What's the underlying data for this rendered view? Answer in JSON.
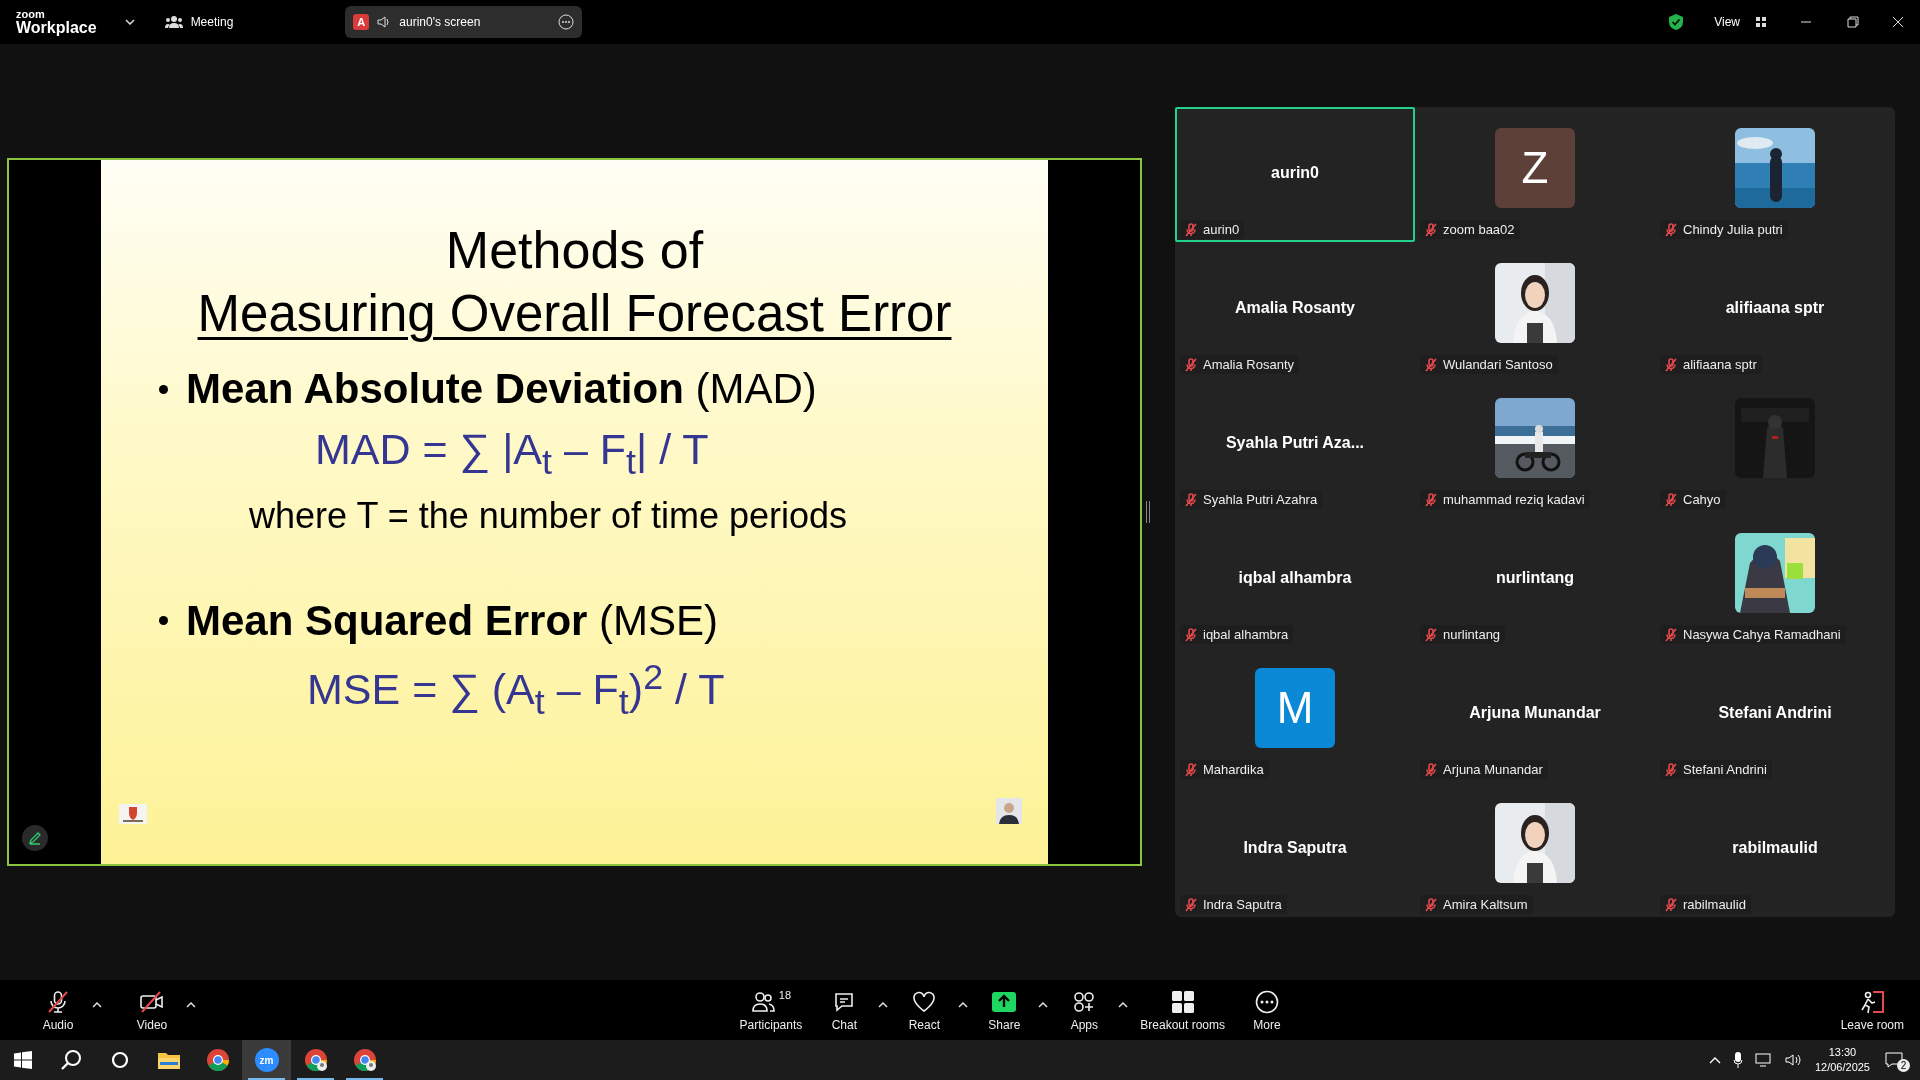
{
  "title_bar": {
    "logo_small": "zoom",
    "logo": "Workplace",
    "meeting_label": "Meeting",
    "share_pill": {
      "badge": "A",
      "label": "aurin0's screen"
    },
    "view_label": "View"
  },
  "shared_screen": {
    "slide": {
      "title_line1": "Methods of",
      "title_line2": "Measuring Overall Forecast Error",
      "sections": [
        {
          "heading": "**Mean Absolute Deviation** (MAD)",
          "formula": "MAD = ∑ |A$_{t}$ – F$_{t}$| / T",
          "note": "where T = the number of time periods"
        },
        {
          "heading": "**Mean Squared Error** (MSE)",
          "formula": "MSE = ∑ (A$_{t}$ – F$_{t}$)$^{2}$ / T"
        }
      ]
    }
  },
  "gallery": [
    {
      "kind": "name",
      "display": "aurin0",
      "name": "aurin0",
      "muted": true,
      "selected": true
    },
    {
      "kind": "initial",
      "display": "Z",
      "color": "#5d4037",
      "name": "zoom baa02",
      "muted": true,
      "selected": false
    },
    {
      "kind": "picture",
      "name": "Chindy Julia putri",
      "muted": true,
      "selected": false
    },
    {
      "kind": "name",
      "display": "Amalia Rosanty",
      "name": "Amalia Rosanty",
      "muted": true,
      "selected": false
    },
    {
      "kind": "picture",
      "name": "Wulandari Santoso",
      "muted": true,
      "selected": false
    },
    {
      "kind": "name",
      "display": "alifiaana sptr",
      "name": "alifiaana sptr",
      "muted": true,
      "selected": false
    },
    {
      "kind": "name",
      "display": "Syahla Putri Aza...",
      "name": "Syahla Putri Azahra",
      "muted": true,
      "selected": false
    },
    {
      "kind": "picture",
      "name": "muhammad reziq kadavi",
      "muted": true,
      "selected": false
    },
    {
      "kind": "picture",
      "name": "Cahyo",
      "muted": true,
      "selected": false
    },
    {
      "kind": "name",
      "display": "iqbal alhambra",
      "name": "iqbal alhambra",
      "muted": true,
      "selected": false
    },
    {
      "kind": "name",
      "display": "nurlintang",
      "name": "nurlintang",
      "muted": true,
      "selected": false
    },
    {
      "kind": "picture",
      "name": "Nasywa Cahya Ramadhani",
      "muted": true,
      "selected": false
    },
    {
      "kind": "initial",
      "display": "M",
      "color": "#0b88d6",
      "name": "Mahardika",
      "muted": true,
      "selected": false
    },
    {
      "kind": "name",
      "display": "Arjuna Munandar",
      "name": "Arjuna Munandar",
      "muted": true,
      "selected": false
    },
    {
      "kind": "name",
      "display": "Stefani Andrini",
      "name": "Stefani Andrini",
      "muted": true,
      "selected": false
    },
    {
      "kind": "name",
      "display": "Indra Saputra",
      "name": "Indra Saputra",
      "muted": true,
      "selected": false
    },
    {
      "kind": "picture",
      "name": "Amira Kaltsum",
      "muted": true,
      "selected": false
    },
    {
      "kind": "name",
      "display": "rabilmaulid",
      "name": "rabilmaulid",
      "muted": true,
      "selected": false
    }
  ],
  "toolbar": [
    {
      "kind": "audio",
      "label": "Audio",
      "off": true,
      "caret": true
    },
    {
      "kind": "video",
      "label": "Video",
      "off": true,
      "caret": true
    },
    {
      "kind": "participants",
      "label": "Participants",
      "count": "18",
      "caret": false
    },
    {
      "kind": "chat",
      "label": "Chat",
      "caret": true
    },
    {
      "kind": "react",
      "label": "React",
      "caret": true
    },
    {
      "kind": "share",
      "label": "Share",
      "caret": true
    },
    {
      "kind": "apps",
      "label": "Apps",
      "caret": true
    },
    {
      "kind": "breakout",
      "label": "Breakout rooms",
      "caret": false
    },
    {
      "kind": "more",
      "label": "More",
      "caret": false
    },
    {
      "kind": "leave",
      "label": "Leave room",
      "caret": false
    }
  ],
  "taskbar": {
    "apps": [
      {
        "kind": "start",
        "active": false
      },
      {
        "kind": "search",
        "active": false
      },
      {
        "kind": "cortana",
        "active": false
      },
      {
        "kind": "explorer",
        "active": false
      },
      {
        "kind": "chrome",
        "active": false
      },
      {
        "kind": "zoom",
        "label": "zm",
        "active": true
      },
      {
        "kind": "chrome",
        "active": false,
        "open": true
      },
      {
        "kind": "chrome",
        "active": false,
        "open": true
      }
    ],
    "time": "13:30",
    "date": "12/06/2025",
    "notifications": "2"
  }
}
